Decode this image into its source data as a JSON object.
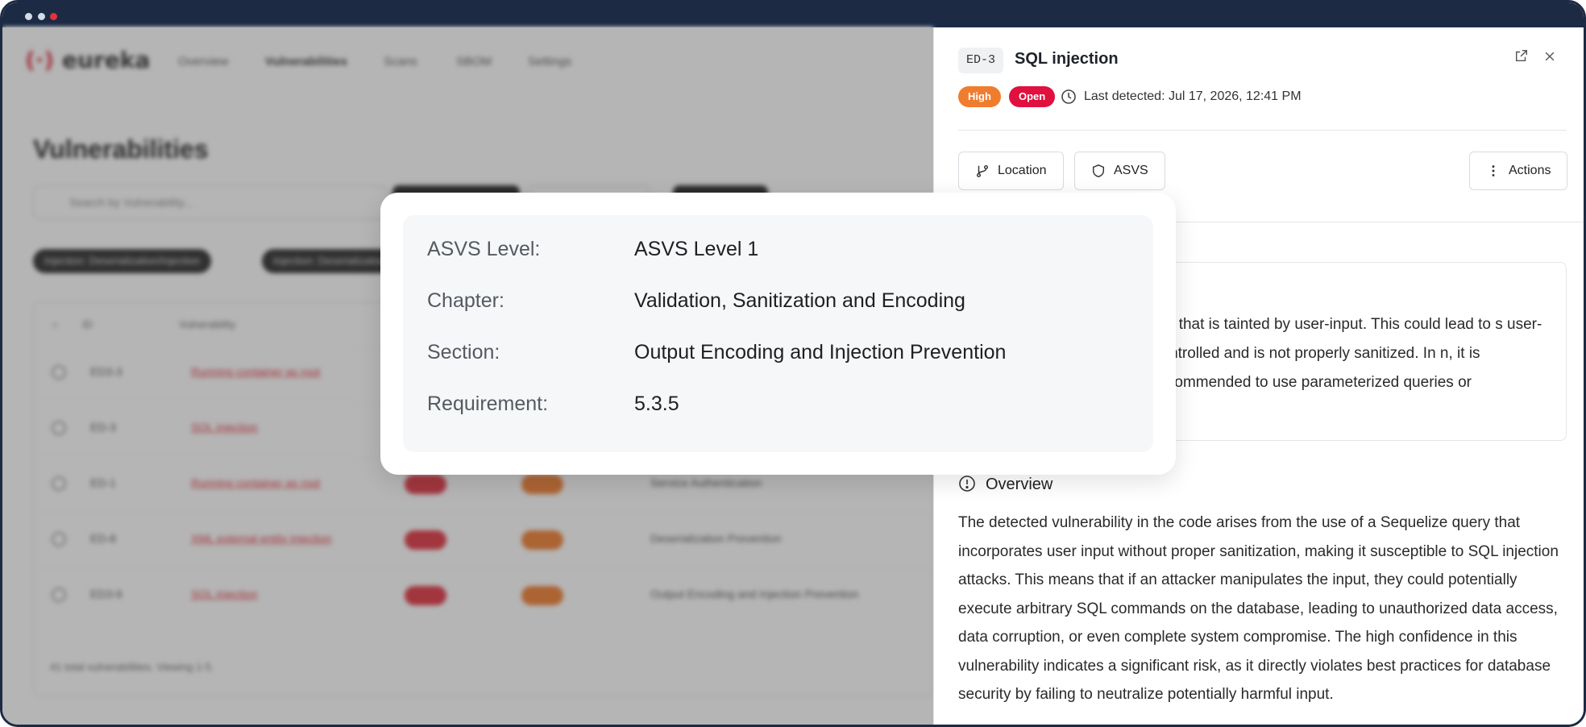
{
  "window": {
    "controls": [
      "minimize",
      "maximize",
      "close"
    ]
  },
  "background": {
    "logo_text": "eureka",
    "nav": [
      "Overview",
      "Vulnerabilities",
      "Scans",
      "SBOM",
      "Settings"
    ],
    "page_title": "Vulnerabilities",
    "search_placeholder": "Search by Vulnerability...",
    "chips": [
      "Injection: Deserialization/Injection",
      "Injection: Deserialization"
    ],
    "table_headers": [
      "ID",
      "Vulnerability"
    ],
    "rows": [
      {
        "id": "ED3-3",
        "name": "Running container as root",
        "section": ""
      },
      {
        "id": "ED-3",
        "name": "SQL injection",
        "section": ""
      },
      {
        "id": "ED-1",
        "name": "Running container as root",
        "section": "Service Authentication"
      },
      {
        "id": "ED-8",
        "name": "XML external entity injection",
        "section": "Deserialization Prevention"
      },
      {
        "id": "ED3-9",
        "name": "SQL injection",
        "section": "Output Encoding and Injection Prevention"
      }
    ],
    "footer": "41 total vulnerabilities. Viewing 1-5."
  },
  "panel": {
    "id_tag": "ED-3",
    "title": "SQL injection",
    "severity": "High",
    "status": "Open",
    "last_detected": "Last detected: Jul 17, 2026, 12:41 PM",
    "buttons": {
      "location": "Location",
      "asvs": "ASVS",
      "actions": "Actions"
    },
    "description_partial": "ent that is tainted by user-input. This could lead to s user-controlled and is not properly sanitized. In n, it is recommended to use parameterized queries or",
    "overview_heading": "Overview",
    "overview_text": "The detected vulnerability in the code arises from the use of a Sequelize query that incorporates user input without proper sanitization, making it susceptible to SQL injection attacks. This means that if an attacker manipulates the input, they could potentially execute arbitrary SQL commands on the database, leading to unauthorized data access, data corruption, or even complete system compromise. The high confidence in this vulnerability indicates a significant risk, as it directly violates best practices for database security by failing to neutralize potentially harmful input."
  },
  "asvs_popover": {
    "rows": [
      {
        "label": "ASVS Level:",
        "value": "ASVS Level 1"
      },
      {
        "label": "Chapter:",
        "value": "Validation, Sanitization and Encoding"
      },
      {
        "label": "Section:",
        "value": "Output Encoding and Injection Prevention"
      },
      {
        "label": "Requirement:",
        "value": "5.3.5"
      }
    ]
  },
  "colors": {
    "chrome": "#1c2a44",
    "high": "#f07c2e",
    "open": "#e0103f",
    "accent": "#e0323f"
  }
}
